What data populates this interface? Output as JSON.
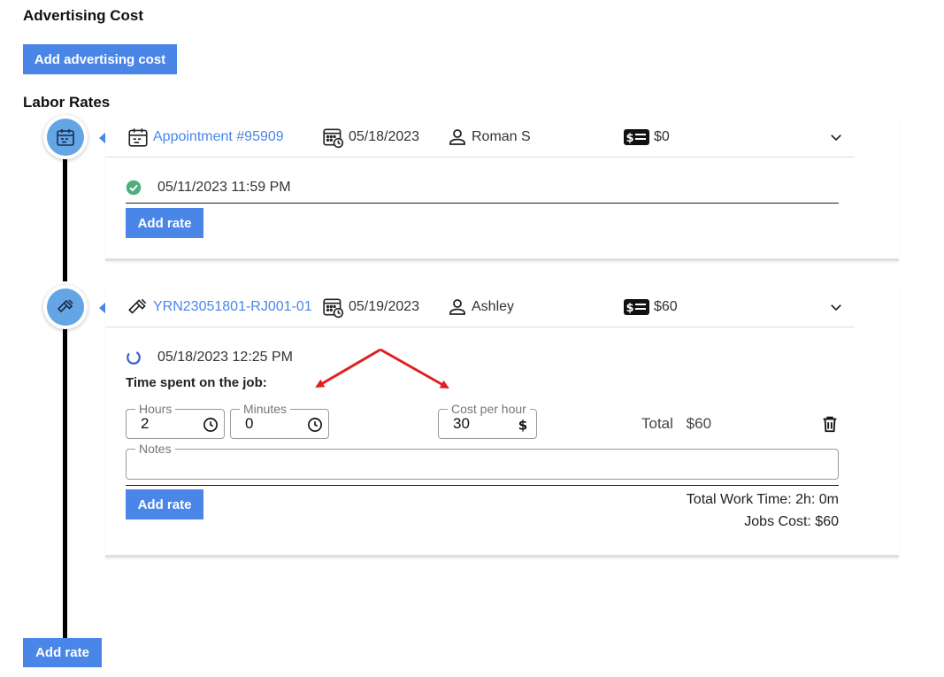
{
  "advertising": {
    "title": "Advertising Cost",
    "add_button": "Add advertising cost"
  },
  "labor": {
    "title": "Labor Rates",
    "entries": [
      {
        "node_icon": "calendar-icon",
        "type_icon": "calendar-icon",
        "reference": "Appointment #95909",
        "date": "05/18/2023",
        "person": "Roman S",
        "cost": "$0",
        "status_icon": "check-circle-icon",
        "status_time": "05/11/2023 11:59 PM",
        "add_rate": "Add rate"
      },
      {
        "node_icon": "hammer-icon",
        "type_icon": "hammer-icon",
        "reference": "YRN23051801-RJ001-01",
        "date": "05/19/2023",
        "person": "Ashley",
        "cost": "$60",
        "status_icon": "progress-circle-icon",
        "status_time": "05/18/2023 12:25 PM",
        "time_spent_label": "Time spent on the job:",
        "hours_label": "Hours",
        "hours_value": "2",
        "minutes_label": "Minutes",
        "minutes_value": "0",
        "cost_per_hour_label": "Cost per hour",
        "cost_per_hour_value": "30",
        "total_label": "Total",
        "total_value": "$60",
        "notes_label": "Notes",
        "notes_value": "",
        "add_rate": "Add rate",
        "total_work_time": "Total Work Time: 2h: 0m",
        "jobs_cost": "Jobs Cost: $60"
      }
    ],
    "add_rate_bottom": "Add rate"
  },
  "colors": {
    "accent": "#4a86e8",
    "node": "#64a5e6",
    "success": "#4caf7d",
    "annotation_arrow": "#e02020"
  }
}
